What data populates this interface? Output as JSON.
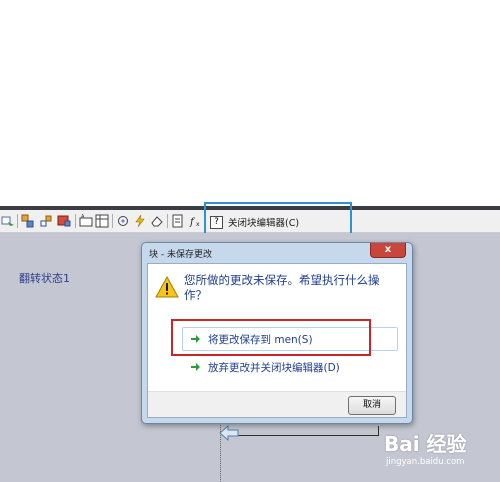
{
  "toolbar": {
    "help_glyph": "?",
    "close_editor_label": "关闭块编辑器(C)"
  },
  "canvas": {
    "flip_state_label": "翻转状态1"
  },
  "dialog": {
    "title": "块 - 未保存更改",
    "close_glyph": "x",
    "message": "您所做的更改未保存。希望执行什么操作？",
    "save_option": "将更改保存到 men(S)",
    "discard_option": "放弃更改并关闭块编辑器(D)",
    "cancel_label": "取消"
  },
  "watermark": {
    "logo_text": "Bai 经验",
    "url": "jingyan.baidu.com"
  },
  "colors": {
    "highlight_blue": "#2c93d6",
    "highlight_red": "#c8262b",
    "link_text": "#1e3d8f",
    "canvas_bg": "#c4c7d1"
  }
}
